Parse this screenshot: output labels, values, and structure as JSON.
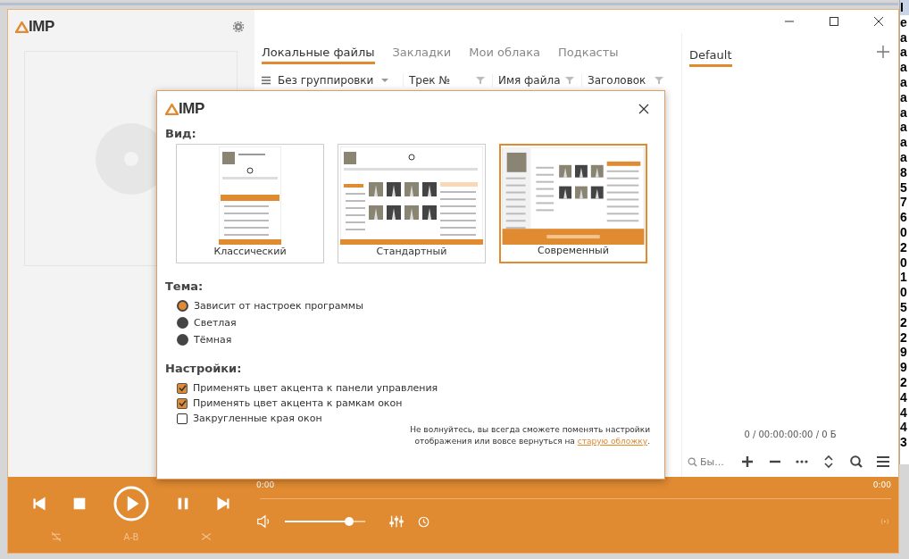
{
  "sidebar": {
    "logo_text": "IMP"
  },
  "library_tabs": [
    {
      "label": "Локальные файлы",
      "selected": true
    },
    {
      "label": "Закладки",
      "selected": false
    },
    {
      "label": "Мои облака",
      "selected": false
    },
    {
      "label": "Подкасты",
      "selected": false
    }
  ],
  "table_header": {
    "grouping": "Без группировки",
    "columns": [
      "Трек №",
      "Имя файла",
      "Заголовок"
    ]
  },
  "playlist": {
    "tabs": [
      {
        "label": "Default",
        "selected": true
      }
    ],
    "summary": "0 / 00:00:00:00 / 0 Б",
    "search": {
      "placeholder": "Бы..."
    }
  },
  "player": {
    "elapsed": "0:00",
    "remaining": "0:00",
    "ab_label": "A-B"
  },
  "dialog": {
    "logo_text": "IMP",
    "view_heading": "Вид:",
    "skins": [
      {
        "label": "Классический",
        "kind": "classic",
        "selected": false
      },
      {
        "label": "Стандартный",
        "kind": "standard",
        "selected": false
      },
      {
        "label": "Современный",
        "kind": "modern",
        "selected": true
      }
    ],
    "theme_heading": "Тема:",
    "themes": [
      {
        "label": "Зависит от настроек программы",
        "selected": true
      },
      {
        "label": "Светлая",
        "selected": false
      },
      {
        "label": "Тёмная",
        "selected": false
      }
    ],
    "settings_heading": "Настройки:",
    "settings": [
      {
        "label": "Применять цвет акцента к панели управления",
        "checked": true
      },
      {
        "label": "Применять цвет акцента к рамкам окон",
        "checked": true
      },
      {
        "label": "Закругленные края окон",
        "checked": false
      }
    ],
    "note": "Не волнуйтесь, вы всегда сможете поменять настройки\nотображения или вовсе вернуться на ",
    "note_link": "старую обложку",
    "note_end": "."
  },
  "background_window": {
    "lines": [
      "I",
      "e",
      "a",
      "a",
      "a",
      "a",
      "a",
      "a",
      "a",
      "a",
      "a",
      "8",
      "5",
      "7",
      "6",
      "0",
      "2",
      "0",
      "1",
      "0",
      "5",
      "2",
      "2",
      "9",
      "9",
      "2",
      "4",
      "4",
      "4",
      "3"
    ]
  }
}
